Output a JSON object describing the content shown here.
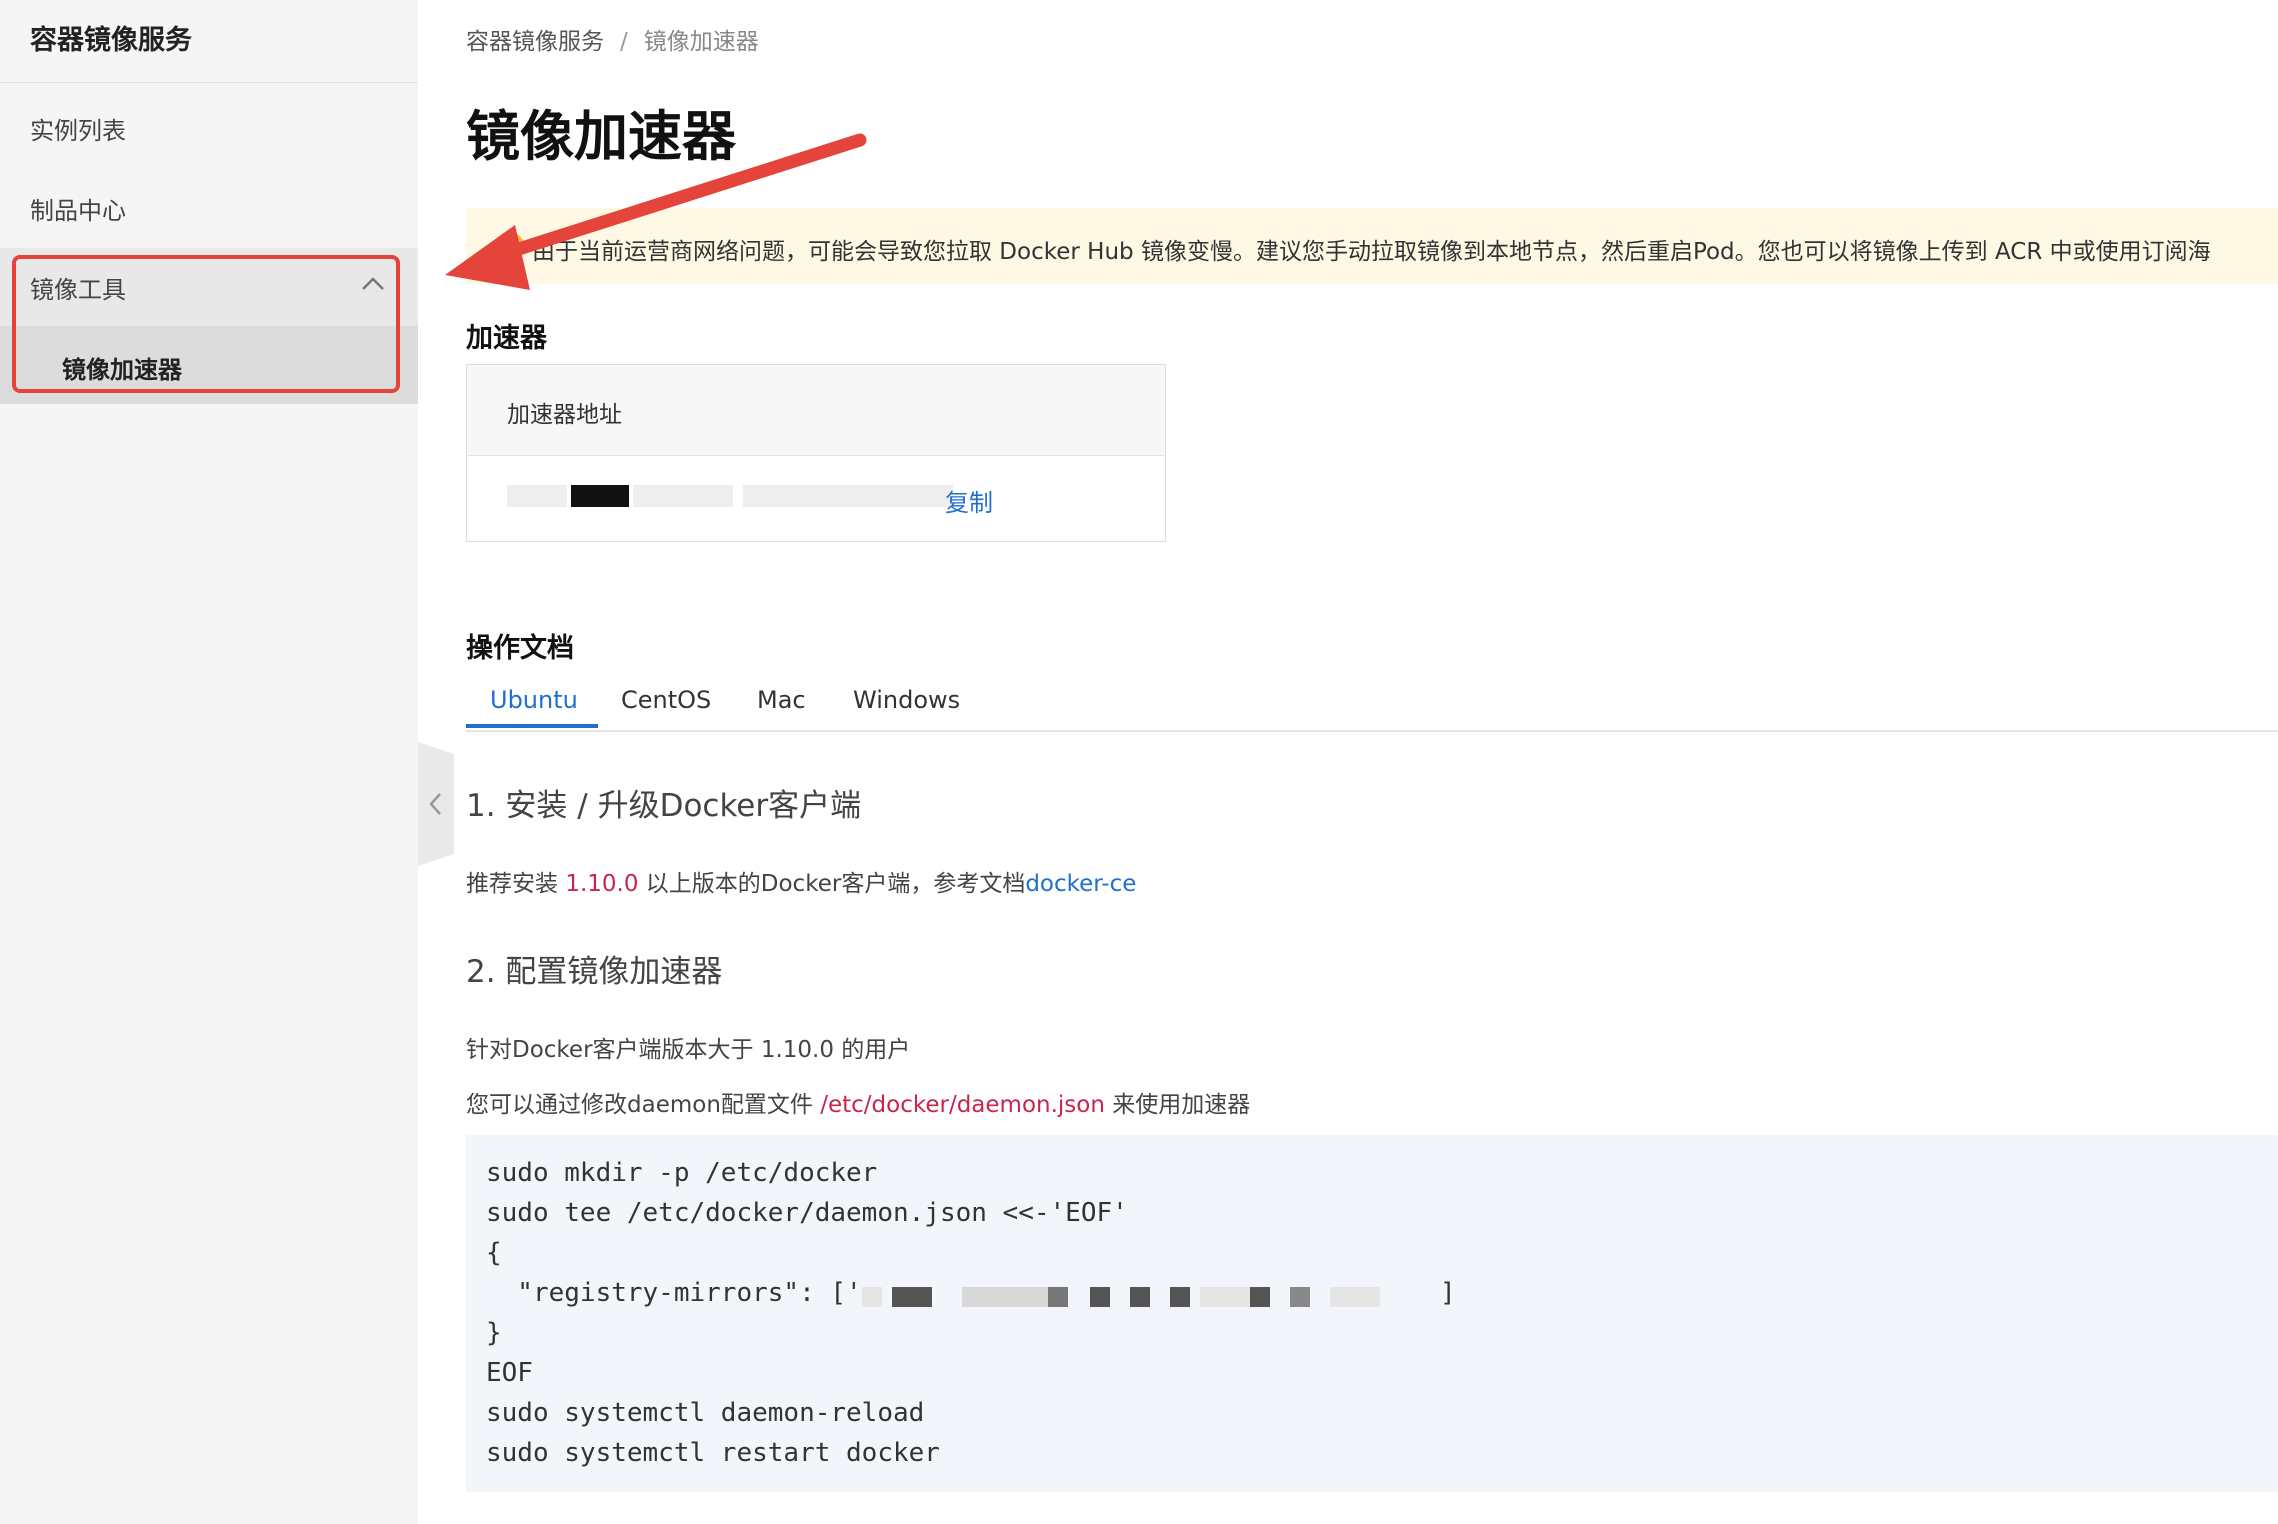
{
  "sidebar": {
    "title": "容器镜像服务",
    "items": [
      {
        "label": "实例列表"
      },
      {
        "label": "制品中心"
      }
    ],
    "group": {
      "label": "镜像工具",
      "expanded": true,
      "chevron_icon": "chevron-up-icon"
    },
    "sub_item": {
      "label": "镜像加速器",
      "active": true
    }
  },
  "breadcrumb": {
    "root": "容器镜像服务",
    "separator": "/",
    "current": "镜像加速器"
  },
  "page_title": "镜像加速器",
  "notice": {
    "icon": "warning-icon",
    "text": "由于当前运营商网络问题，可能会导致您拉取 Docker Hub 镜像变慢。建议您手动拉取镜像到本地节点，然后重启Pod。您也可以将镜像上传到 ACR 中或使用订阅海"
  },
  "accelerator": {
    "section_title": "加速器",
    "column_header": "加速器地址",
    "address_partial": "…",
    "copy_label": "复制"
  },
  "docs": {
    "section_title": "操作文档",
    "tabs": [
      "Ubuntu",
      "CentOS",
      "Mac",
      "Windows"
    ],
    "active_tab": "Ubuntu",
    "step1": {
      "title": "1. 安装 / 升级Docker客户端",
      "text_before": "推荐安装 ",
      "version": "1.10.0",
      "text_middle": " 以上版本的Docker客户端，参考文档",
      "link": "docker-ce"
    },
    "step2": {
      "title": "2. 配置镜像加速器",
      "line1": "针对Docker客户端版本大于 1.10.0 的用户",
      "line2_before": "您可以通过修改daemon配置文件 ",
      "line2_path": "/etc/docker/daemon.json",
      "line2_after": " 来使用加速器"
    },
    "code_lines": [
      "sudo mkdir -p /etc/docker",
      "sudo tee /etc/docker/daemon.json <<-'EOF'",
      "{",
      "  \"registry-mirrors\": ['",
      "}",
      "EOF",
      "sudo systemctl daemon-reload",
      "sudo systemctl restart docker"
    ],
    "code_line4_tail": "]"
  },
  "colors": {
    "accent": "#1f6fd1",
    "highlight_box": "#e5443a",
    "notice_bg": "#fff8e5",
    "code_bg": "#f2f6fb",
    "sidebar_bg": "#f5f5f5"
  }
}
